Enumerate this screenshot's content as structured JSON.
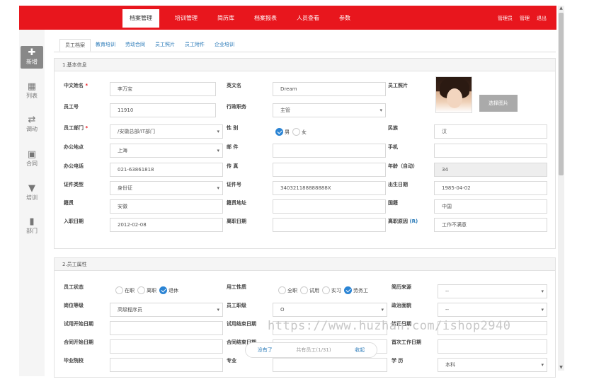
{
  "top_nav": [
    "档案管理",
    "培训管理",
    "简历库",
    "档案报表",
    "人员查看",
    "参数"
  ],
  "top_right": [
    "管理员",
    "管理",
    "退出"
  ],
  "sidebar": [
    {
      "label": "新增",
      "icon": "plus-icon"
    },
    {
      "label": "列表",
      "icon": "grid-icon"
    },
    {
      "label": "调动",
      "icon": "shuffle-icon"
    },
    {
      "label": "合同",
      "icon": "inbox-icon"
    },
    {
      "label": "培训",
      "icon": "funnel-icon"
    },
    {
      "label": "部门",
      "icon": "document-icon"
    }
  ],
  "tabs": [
    "员工档案",
    "教育培训",
    "劳动合同",
    "员工照片",
    "员工附件",
    "企业培训"
  ],
  "basic": {
    "section_title": "1.基本信息",
    "name_cn": {
      "label": "中文姓名",
      "value": "李万宝"
    },
    "name_en": {
      "label": "英文名",
      "value": "Dream"
    },
    "photo": {
      "label": "员工照片",
      "button": "选择图片"
    },
    "emp_no": {
      "label": "员工号",
      "value": "11910"
    },
    "position": {
      "label": "行政职务",
      "value": "主管"
    },
    "dept": {
      "label": "员工部门",
      "value": "/安徽总部/IT部门"
    },
    "gender": {
      "label": "性 别",
      "opt_male": "男",
      "opt_female": "女"
    },
    "ethnic": {
      "label": "民族",
      "value": "汉"
    },
    "office": {
      "label": "办公地点",
      "value": "上海"
    },
    "email": {
      "label": "邮 件",
      "value": ""
    },
    "mobile": {
      "label": "手机",
      "value": ""
    },
    "office_phone": {
      "label": "办公电话",
      "value": "021-63861818"
    },
    "fax": {
      "label": "传 真",
      "value": ""
    },
    "age": {
      "label": "年龄（自动）",
      "value": "34"
    },
    "id_type": {
      "label": "证件类型",
      "value": "身份证"
    },
    "id_no": {
      "label": "证件号",
      "value": "340321188888888X"
    },
    "birthday": {
      "label": "出生日期",
      "value": "1985-04-02"
    },
    "native": {
      "label": "籍贯",
      "value": "安徽"
    },
    "native_addr": {
      "label": "籍贯地址",
      "value": ""
    },
    "nationality": {
      "label": "国籍",
      "value": "中国"
    },
    "hire_date": {
      "label": "入职日期",
      "value": "2012-02-08"
    },
    "leave_date": {
      "label": "离职日期",
      "value": ""
    },
    "leave_reason": {
      "label": "离职原因",
      "flag": "(R)",
      "value": "工作不满意"
    }
  },
  "attr": {
    "section_title": "2.员工属性",
    "status": {
      "label": "员工状态",
      "opts": [
        "在职",
        "离职",
        "退休"
      ]
    },
    "emp_type": {
      "label": "用工性质",
      "opts": [
        "全职",
        "试用",
        "实习",
        "劳务工"
      ]
    },
    "resume_src": {
      "label": "简历来源",
      "value": "--"
    },
    "post_level": {
      "label": "岗位等级",
      "value": "高级程序员"
    },
    "title": {
      "label": "员工职级",
      "value": "O"
    },
    "politics": {
      "label": "政治面貌",
      "value": "--"
    },
    "trial_start": {
      "label": "试用开始日期",
      "value": ""
    },
    "trial_end": {
      "label": "试用结束日期",
      "value": ""
    },
    "regular_date": {
      "label": "转正日期",
      "value": ""
    },
    "contract_start": {
      "label": "合同开始日期",
      "value": ""
    },
    "contract_end": {
      "label": "合同结束日期",
      "value": ""
    },
    "first_work": {
      "label": "首次工作日期",
      "value": ""
    },
    "school": {
      "label": "毕业院校",
      "value": ""
    },
    "major": {
      "label": "专业",
      "value": ""
    },
    "education": {
      "label": "学 历",
      "value": "本科"
    }
  },
  "pager": {
    "none": "没有了",
    "info": "共有员工(1/31)",
    "collapse": "收起"
  },
  "watermark": "https://www.huzhan.com/ishop2940"
}
